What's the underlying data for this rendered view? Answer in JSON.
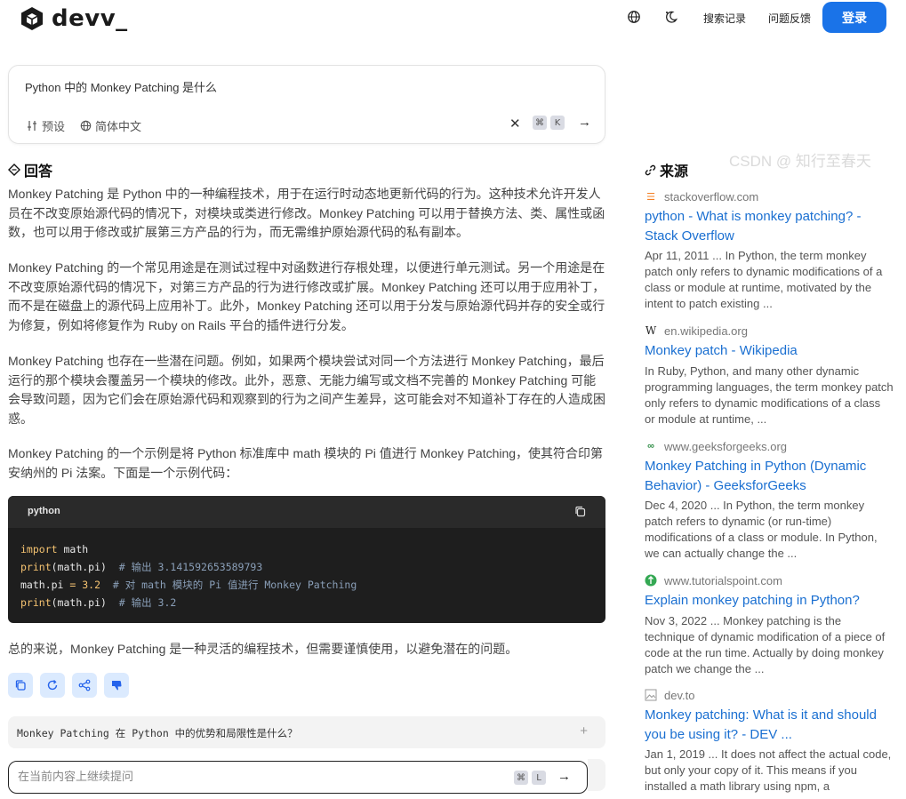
{
  "header": {
    "logo_text": "devv_",
    "search_history": "搜索记录",
    "feedback": "问题反馈",
    "login": "登录"
  },
  "query": {
    "text": "Python 中的 Monkey Patching 是什么",
    "preset": "预设",
    "language": "简体中文",
    "kbd_cmd": "⌘",
    "kbd_k": "K"
  },
  "answer": {
    "heading": "回答",
    "paragraphs": [
      "Monkey Patching 是 Python 中的一种编程技术，用于在运行时动态地更新代码的行为。这种技术允许开发人员在不改变原始源代码的情况下，对模块或类进行修改。Monkey Patching 可以用于替换方法、类、属性或函数，也可以用于修改或扩展第三方产品的行为，而无需维护原始源代码的私有副本。",
      "Monkey Patching 的一个常见用途是在测试过程中对函数进行存根处理，以便进行单元测试。另一个用途是在不改变原始源代码的情况下，对第三方产品的行为进行修改或扩展。Monkey Patching 还可以用于应用补丁，而不是在磁盘上的源代码上应用补丁。此外，Monkey Patching 还可以用于分发与原始源代码并存的安全或行为修复，例如将修复作为 Ruby on Rails 平台的插件进行分发。",
      "Monkey Patching 也存在一些潜在问题。例如，如果两个模块尝试对同一个方法进行 Monkey Patching，最后运行的那个模块会覆盖另一个模块的修改。此外，恶意、无能力编写或文档不完善的 Monkey Patching 可能会导致问题，因为它们会在原始源代码和观察到的行为之间产生差异，这可能会对不知道补丁存在的人造成困惑。",
      "Monkey Patching 的一个示例是将 Python 标准库中 math 模块的 Pi 值进行 Monkey Patching，使其符合印第安纳州的 Pi 法案。下面是一个示例代码："
    ],
    "code_lang": "python",
    "code": {
      "l1_kw": "import",
      "l1_rest": " math",
      "l2_fn": "print",
      "l2_rest": "(math.pi)",
      "l2_cm": "  # 输出 3.141592653589793",
      "l3_a": "math.pi",
      "l3_op": " = ",
      "l3_num": "3.2",
      "l3_cm": "  # 对 math 模块的 Pi 值进行 Monkey Patching",
      "l4_fn": "print",
      "l4_rest": "(math.pi)",
      "l4_cm": "  # 输出 3.2"
    },
    "summary": "总的来说，Monkey Patching 是一种灵活的编程技术，但需要谨慎使用，以避免潜在的问题。"
  },
  "related": {
    "question": "Monkey Patching 在 Python 中的优势和局限性是什么？",
    "plus": "+"
  },
  "followup": {
    "placeholder": "在当前内容上继续提问",
    "kbd_cmd": "⌘",
    "kbd_l": "L"
  },
  "sources": {
    "heading": "来源",
    "items": [
      {
        "domain": "stackoverflow.com",
        "title": "python - What is monkey patching? - Stack Overflow",
        "snippet": "Apr 11, 2011 ... In Python, the term monkey patch only refers to dynamic modifications of a class or module at runtime, motivated by the intent to patch existing ..."
      },
      {
        "domain": "en.wikipedia.org",
        "title": "Monkey patch - Wikipedia",
        "snippet": "In Ruby, Python, and many other dynamic programming languages, the term monkey patch only refers to dynamic modifications of a class or module at runtime, ..."
      },
      {
        "domain": "www.geeksforgeeks.org",
        "title": "Monkey Patching in Python (Dynamic Behavior) - GeeksforGeeks",
        "snippet": "Dec 4, 2020 ... In Python, the term monkey patch refers to dynamic (or run-time) modifications of a class or module. In Python, we can actually change the ..."
      },
      {
        "domain": "www.tutorialspoint.com",
        "title": "Explain monkey patching in Python?",
        "snippet": "Nov 3, 2022 ... Monkey patching is the technique of dynamic modification of a piece of code at the run time. Actually by doing monkey patch we change the ..."
      },
      {
        "domain": "dev.to",
        "title": "Monkey patching: What is it and should you be using it? - DEV ...",
        "snippet": "Jan 1, 2019 ... It does not affect the actual code, but only your copy of it. This means if you installed a math library using npm, a"
      }
    ]
  },
  "watermark": "CSDN @ 知行至春天"
}
